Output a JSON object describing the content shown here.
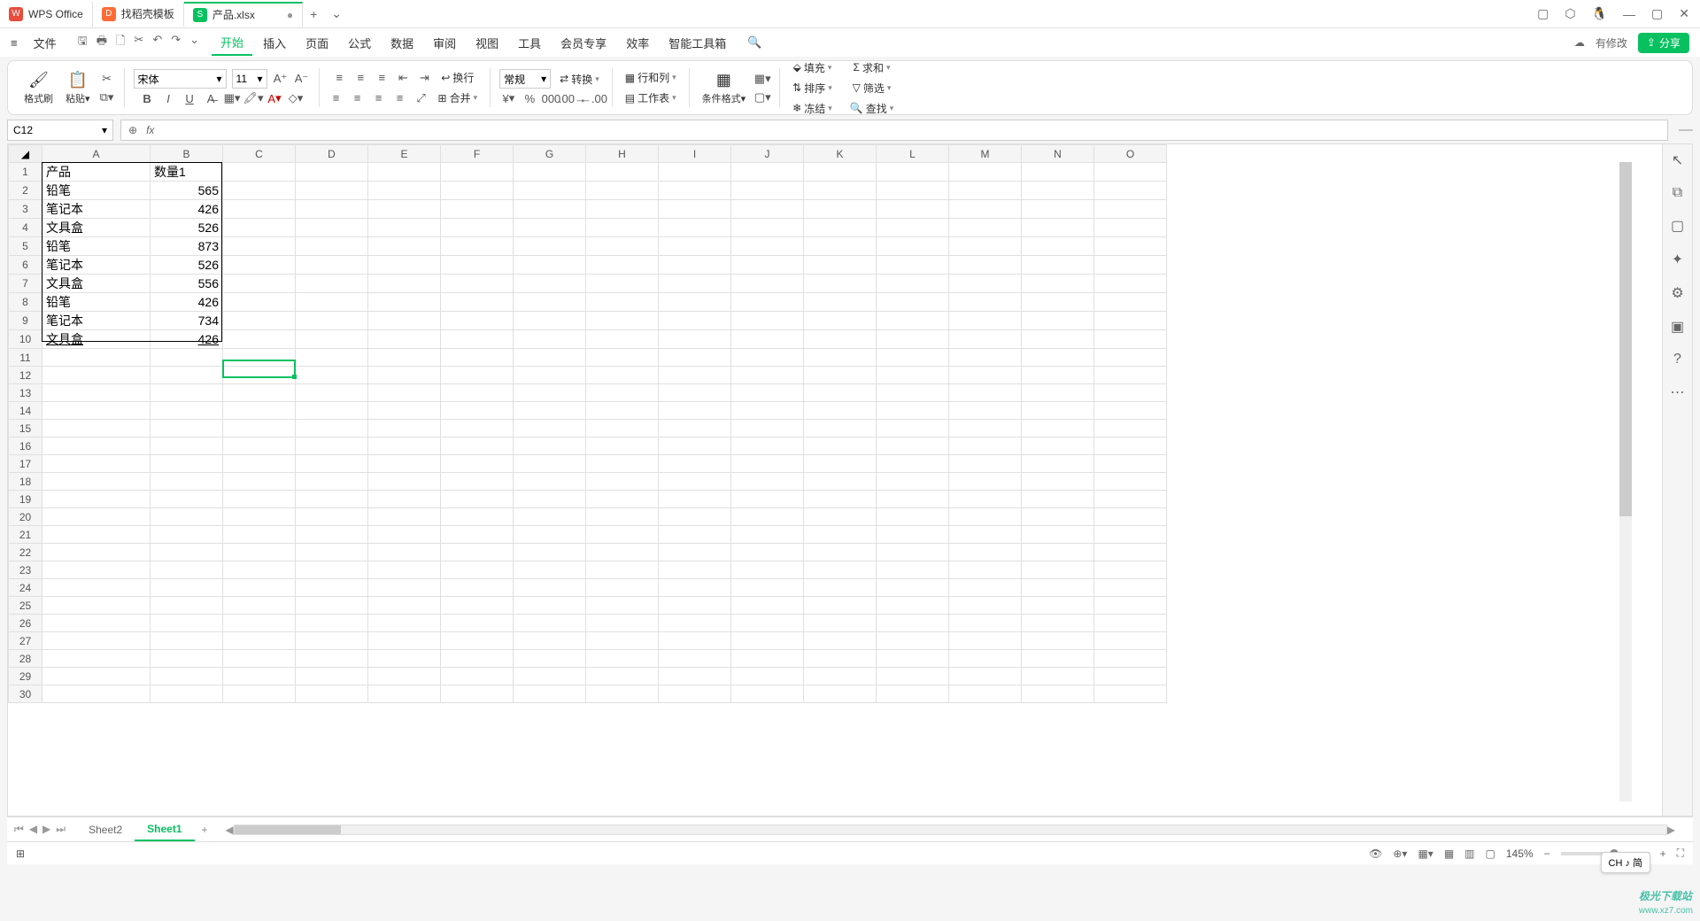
{
  "titlebar": {
    "tabs": [
      {
        "icon": "W",
        "label": "WPS Office"
      },
      {
        "icon": "D",
        "label": "找稻壳模板"
      },
      {
        "icon": "S",
        "label": "产品.xlsx",
        "dirty": "●"
      }
    ],
    "add": "+",
    "add_chev": "⌄"
  },
  "menu": {
    "file": "文件",
    "items": [
      "开始",
      "插入",
      "页面",
      "公式",
      "数据",
      "审阅",
      "视图",
      "工具",
      "会员专享",
      "效率",
      "智能工具箱"
    ],
    "active": "开始",
    "right_status": "有修改",
    "share": "分享"
  },
  "ribbon": {
    "format_brush": "格式刷",
    "paste": "粘贴",
    "font_name": "宋体",
    "font_size": "11",
    "wrap": "换行",
    "number_format": "常规",
    "convert": "转换",
    "row_col": "行和列",
    "worksheet": "工作表",
    "cond_format": "条件格式",
    "merge": "合并",
    "fill": "填充",
    "sort": "排序",
    "freeze": "冻结",
    "sum": "求和",
    "filter": "筛选",
    "find": "查找"
  },
  "namebox": "C12",
  "fx_label": "fx",
  "columns": [
    "A",
    "B",
    "C",
    "D",
    "E",
    "F",
    "G",
    "H",
    "I",
    "J",
    "K",
    "L",
    "M",
    "N",
    "O"
  ],
  "rows": [
    1,
    2,
    3,
    4,
    5,
    6,
    7,
    8,
    9,
    10,
    11,
    12,
    13,
    14,
    15,
    16,
    17,
    18,
    19,
    20,
    21,
    22,
    23,
    24,
    25,
    26,
    27,
    28,
    29,
    30
  ],
  "data": {
    "header": {
      "A": "产品",
      "B": "数量1"
    },
    "body": [
      {
        "A": "铅笔",
        "B": "565"
      },
      {
        "A": "笔记本",
        "B": "426"
      },
      {
        "A": "文具盒",
        "B": "526"
      },
      {
        "A": "铅笔",
        "B": "873"
      },
      {
        "A": "笔记本",
        "B": "526"
      },
      {
        "A": "文具盒",
        "B": "556"
      },
      {
        "A": "铅笔",
        "B": "426"
      },
      {
        "A": "笔记本",
        "B": "734"
      },
      {
        "A": "文具盒",
        "B": "426"
      }
    ]
  },
  "sheets": {
    "tabs": [
      "Sheet2",
      "Sheet1"
    ],
    "active": "Sheet1"
  },
  "status": {
    "zoom": "145%"
  },
  "ime": "CH ♪ 简",
  "watermark": {
    "a": "极光下载站",
    "b": "www.xz7.com"
  }
}
